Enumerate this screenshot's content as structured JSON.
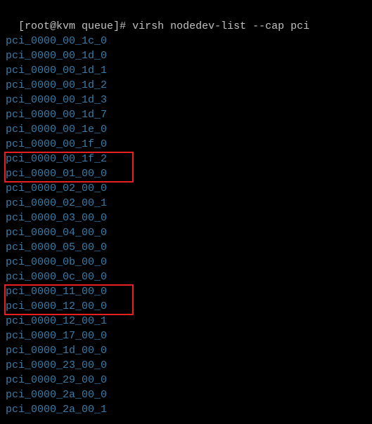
{
  "prompt": {
    "open_bracket": "[",
    "userhost": "root@kvm queue",
    "close_bracket": "]#",
    "command": "virsh nodedev-list --cap pci"
  },
  "output_lines": [
    "pci_0000_00_1c_0",
    "pci_0000_00_1d_0",
    "pci_0000_00_1d_1",
    "pci_0000_00_1d_2",
    "pci_0000_00_1d_3",
    "pci_0000_00_1d_7",
    "pci_0000_00_1e_0",
    "pci_0000_00_1f_0",
    "pci_0000_00_1f_2",
    "pci_0000_01_00_0",
    "pci_0000_02_00_0",
    "pci_0000_02_00_1",
    "pci_0000_03_00_0",
    "pci_0000_04_00_0",
    "pci_0000_05_00_0",
    "pci_0000_0b_00_0",
    "pci_0000_0c_00_0",
    "pci_0000_11_00_0",
    "pci_0000_12_00_0",
    "pci_0000_12_00_1",
    "pci_0000_17_00_0",
    "pci_0000_1d_00_0",
    "pci_0000_23_00_0",
    "pci_0000_29_00_0",
    "pci_0000_2a_00_0",
    "pci_0000_2a_00_1"
  ],
  "highlights": {
    "box1_color": "#e62020",
    "box2_color": "#e62020"
  }
}
